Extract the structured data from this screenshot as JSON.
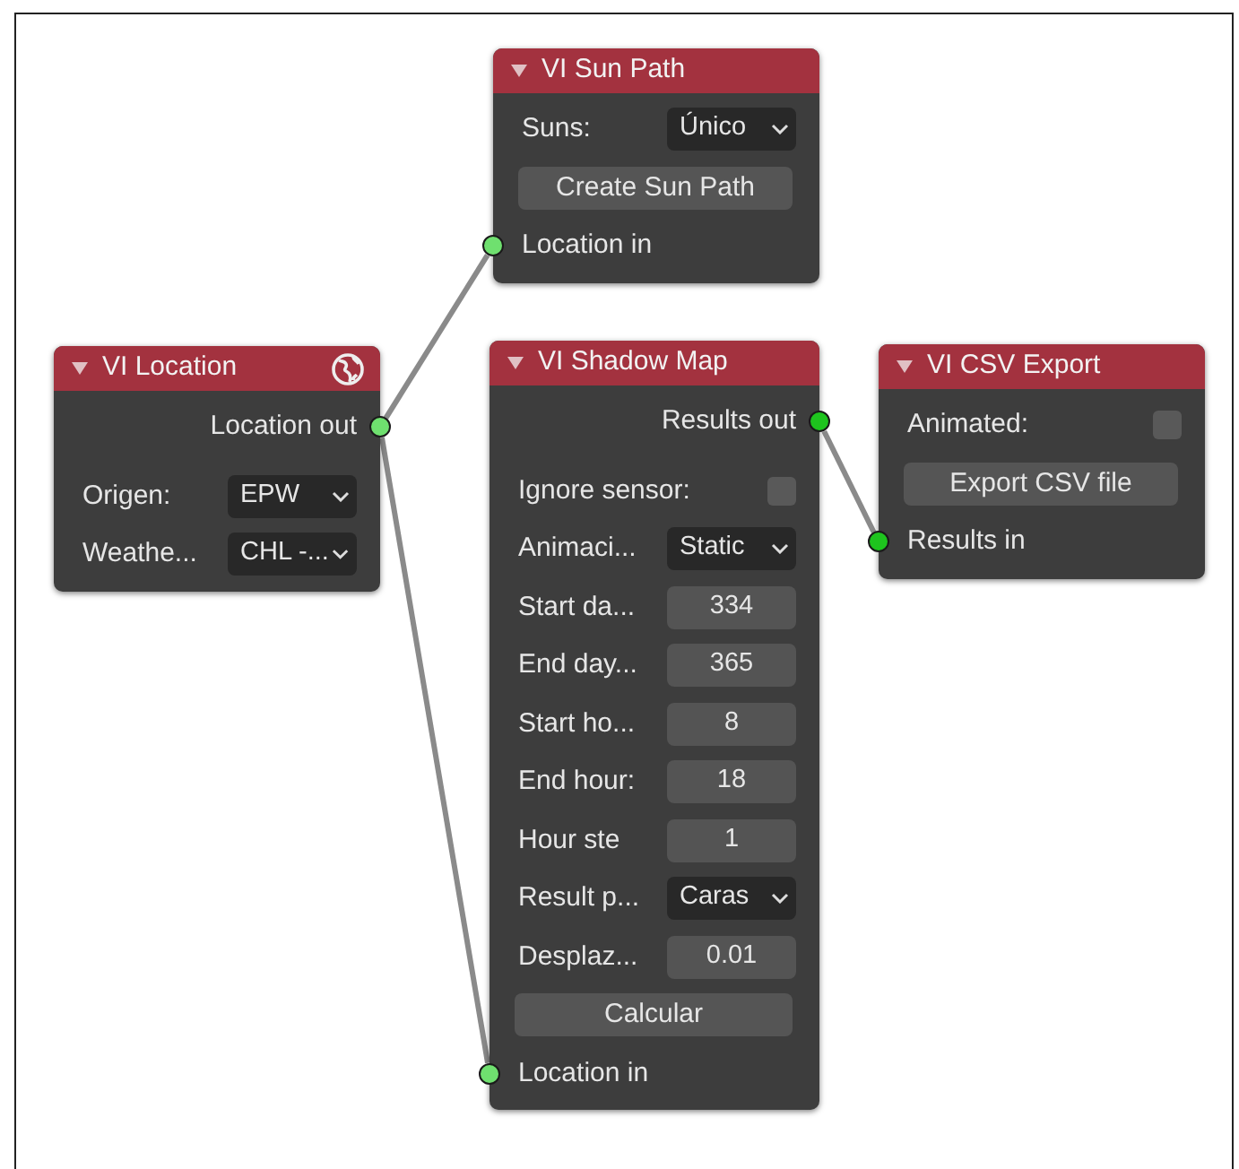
{
  "nodes": [
    {
      "title": "VI Sun Path",
      "header_icon": false,
      "rows": [
        {
          "kind": "select",
          "label": "Suns:",
          "value": "Único"
        },
        {
          "kind": "button",
          "label": "Create Sun Path"
        },
        {
          "kind": "input",
          "label": "Location in",
          "color": "#6fe06f"
        }
      ]
    },
    {
      "title": "VI Location",
      "header_icon": true,
      "rows": [
        {
          "kind": "output",
          "label": "Location out",
          "color": "#6fe06f"
        },
        {
          "kind": "select",
          "label": "Origen:",
          "value": "EPW"
        },
        {
          "kind": "select",
          "label": "Weathe...",
          "value": "CHL -..."
        }
      ]
    },
    {
      "title": "VI Shadow Map",
      "header_icon": false,
      "rows": [
        {
          "kind": "output",
          "label": "Results out",
          "color": "#1ec41e"
        },
        {
          "kind": "checkbox",
          "label": "Ignore sensor:",
          "checked": false
        },
        {
          "kind": "select",
          "label": "Animaci...",
          "value": "Static"
        },
        {
          "kind": "number",
          "label": "Start da...",
          "value": "334"
        },
        {
          "kind": "number",
          "label": "End day...",
          "value": "365"
        },
        {
          "kind": "number",
          "label": "Start ho...",
          "value": "8"
        },
        {
          "kind": "number",
          "label": "End hour:",
          "value": "18"
        },
        {
          "kind": "number",
          "label": "Hour ste",
          "value": "1"
        },
        {
          "kind": "select",
          "label": "Result p...",
          "value": "Caras"
        },
        {
          "kind": "number",
          "label": "Desplaz...",
          "value": "0.01"
        },
        {
          "kind": "button",
          "label": "Calcular"
        },
        {
          "kind": "input",
          "label": "Location in",
          "color": "#6fe06f"
        }
      ]
    },
    {
      "title": "VI CSV Export",
      "header_icon": false,
      "rows": [
        {
          "kind": "checkbox",
          "label": "Animated:",
          "checked": false
        },
        {
          "kind": "button",
          "label": "Export CSV file"
        },
        {
          "kind": "input",
          "label": "Results in",
          "color": "#1ec41e"
        }
      ]
    }
  ]
}
